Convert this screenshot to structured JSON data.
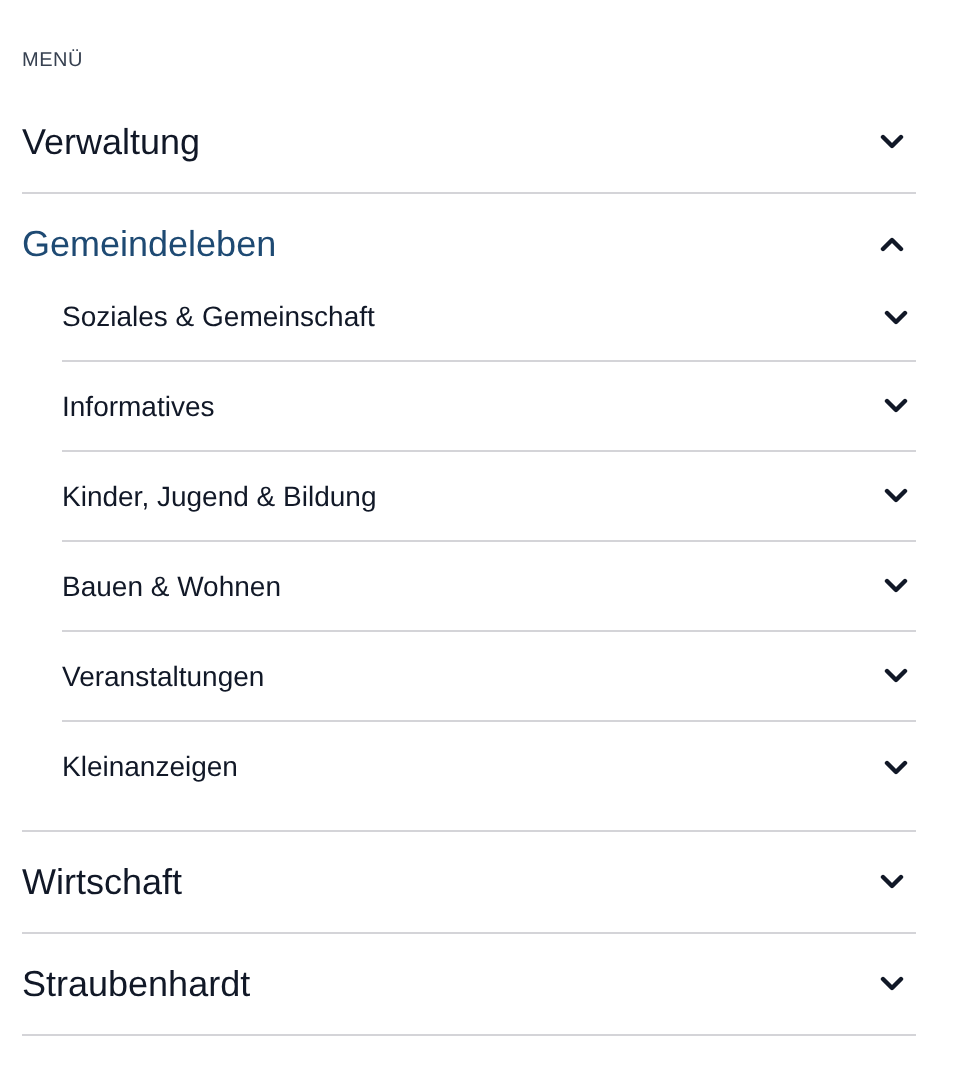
{
  "menu": {
    "title": "MENÜ",
    "items": [
      {
        "label": "Verwaltung",
        "expanded": false
      },
      {
        "label": "Gemeindeleben",
        "expanded": true,
        "children": [
          {
            "label": "Soziales & Gemeinschaft",
            "expanded": false
          },
          {
            "label": "Informatives",
            "expanded": false
          },
          {
            "label": "Kinder, Jugend & Bildung",
            "expanded": false
          },
          {
            "label": "Bauen & Wohnen",
            "expanded": false
          },
          {
            "label": "Veranstaltungen",
            "expanded": false
          },
          {
            "label": "Kleinanzeigen",
            "expanded": false
          }
        ]
      },
      {
        "label": "Wirtschaft",
        "expanded": false
      },
      {
        "label": "Straubenhardt",
        "expanded": false
      }
    ]
  }
}
